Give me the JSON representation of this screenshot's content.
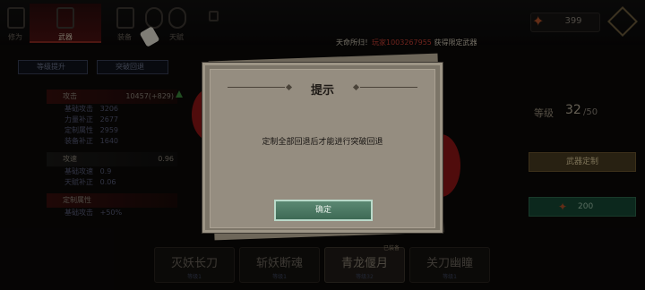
{
  "nav": {
    "tabs": [
      {
        "label": "修为",
        "icon": "cultivation-icon"
      },
      {
        "label": "武器",
        "icon": "sword-icon"
      },
      {
        "label": "装备",
        "icon": "armor-icon"
      },
      {
        "label": "",
        "icon": "relic-icon"
      },
      {
        "label": "天赋",
        "icon": "talent-icon"
      }
    ],
    "resource_value": "399"
  },
  "announcement": {
    "prefix": "天命所归！",
    "player": "玩家1003267955",
    "suffix": " 获得限定武器"
  },
  "subtabs": [
    "等级提升",
    "突破回退"
  ],
  "stats": {
    "attack": {
      "label": "攻击",
      "value": "10457(+829)",
      "rows": [
        {
          "label": "基础攻击",
          "value": "3206"
        },
        {
          "label": "力量补正",
          "value": "2677"
        },
        {
          "label": "定制属性",
          "value": "2959"
        },
        {
          "label": "装备补正",
          "value": "1640"
        }
      ]
    },
    "speed": {
      "label": "攻速",
      "value": "0.96",
      "rows": [
        {
          "label": "基础攻速",
          "value": "0.9"
        },
        {
          "label": "天赋补正",
          "value": "0.06"
        }
      ]
    },
    "custom": {
      "label": "定制属性",
      "rows": [
        {
          "label": "基础攻击",
          "value": "+50%"
        }
      ]
    }
  },
  "right_panel": {
    "level_label": "等级",
    "level_value": "32",
    "level_max": "/50",
    "custom_button": "武器定制",
    "upgrade_value": "200"
  },
  "weapons": [
    {
      "name": "灭妖长刀",
      "sub": "等级1"
    },
    {
      "name": "斩妖断魂",
      "sub": "等级1"
    },
    {
      "name": "青龙偃月",
      "sub": "等级32"
    },
    {
      "name": "关刀幽瞳",
      "sub": "等级1"
    }
  ],
  "equipped_tag": "已装备",
  "dialog": {
    "title": "提示",
    "message": "定制全部回退后才能进行突破回退",
    "confirm": "确定"
  }
}
